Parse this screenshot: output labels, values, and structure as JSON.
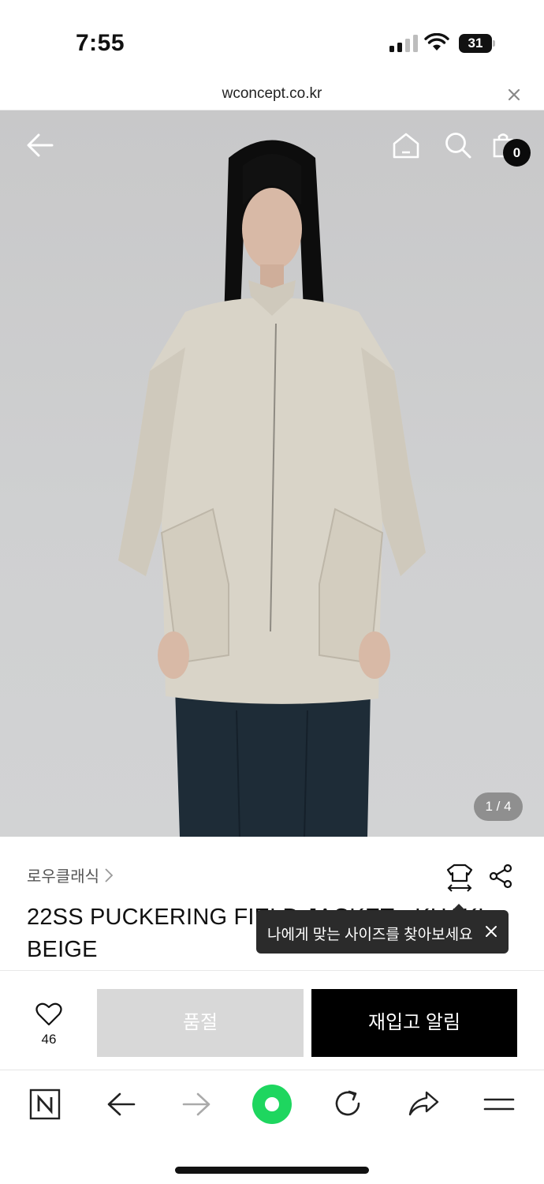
{
  "status_bar": {
    "time": "7:55",
    "battery": "31"
  },
  "browser": {
    "url": "wconcept.co.kr"
  },
  "gallery": {
    "counter": "1 / 4"
  },
  "header": {
    "cart_count": "0"
  },
  "product": {
    "brand": "로우클래식",
    "title": "22SS PUCKERING FIELD JACKET - KHAKI BEIGE"
  },
  "tooltip": {
    "text": "나에게 맞는 사이즈를 찾아보세요"
  },
  "actions": {
    "like_count": "46",
    "soldout_label": "품절",
    "restock_label": "재입고 알림"
  },
  "colors": {
    "accent": "#000000",
    "naver_green": "#1ed65f",
    "disabled": "#d8d8d8"
  }
}
